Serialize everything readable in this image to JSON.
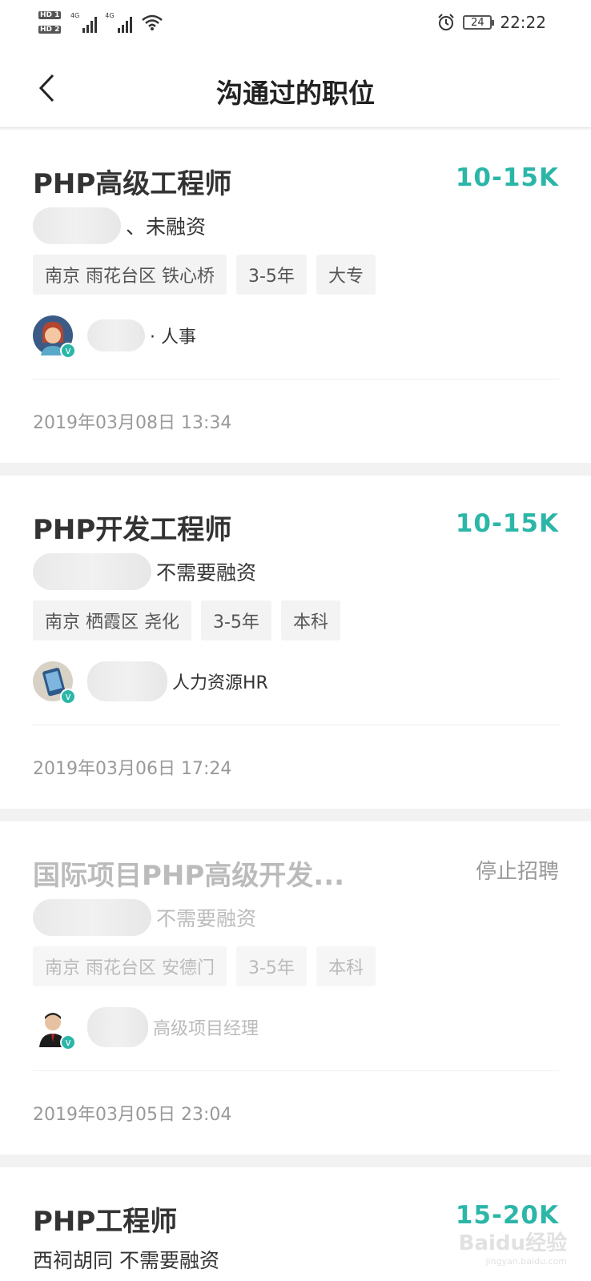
{
  "status_bar": {
    "sim1": "HD 1",
    "sim2": "HD 2",
    "net1": "4G",
    "net2": "4G",
    "battery": "24",
    "time": "22:22"
  },
  "nav": {
    "title": "沟通过的职位"
  },
  "jobs": [
    {
      "title": "PHP高级工程师",
      "salary": "10-15K",
      "company_suffix": "、未融资",
      "tags": [
        "南京 雨花台区 铁心桥",
        "3-5年",
        "大专"
      ],
      "recruiter": "· 人事",
      "date": "2019年03月08日 13:34"
    },
    {
      "title": "PHP开发工程师",
      "salary": "10-15K",
      "company_suffix": "不需要融资",
      "tags": [
        "南京 栖霞区 尧化",
        "3-5年",
        "本科"
      ],
      "recruiter": "人力资源HR",
      "date": "2019年03月06日 17:24"
    },
    {
      "title": "国际项目PHP高级开发...",
      "status": "停止招聘",
      "company_suffix": "不需要融资",
      "tags": [
        "南京 雨花台区 安德门",
        "3-5年",
        "本科"
      ],
      "recruiter": "高级项目经理",
      "date": "2019年03月05日 23:04"
    },
    {
      "title": "PHP工程师",
      "salary": "15-20K",
      "company": "西祠胡同",
      "company_suffix": "不需要融资"
    }
  ],
  "watermark": {
    "text": "Baidu经验",
    "sub": "jingyan.baidu.com"
  },
  "colors": {
    "accent": "#2bb6a8",
    "verified_badge": "#2bb6a8"
  }
}
